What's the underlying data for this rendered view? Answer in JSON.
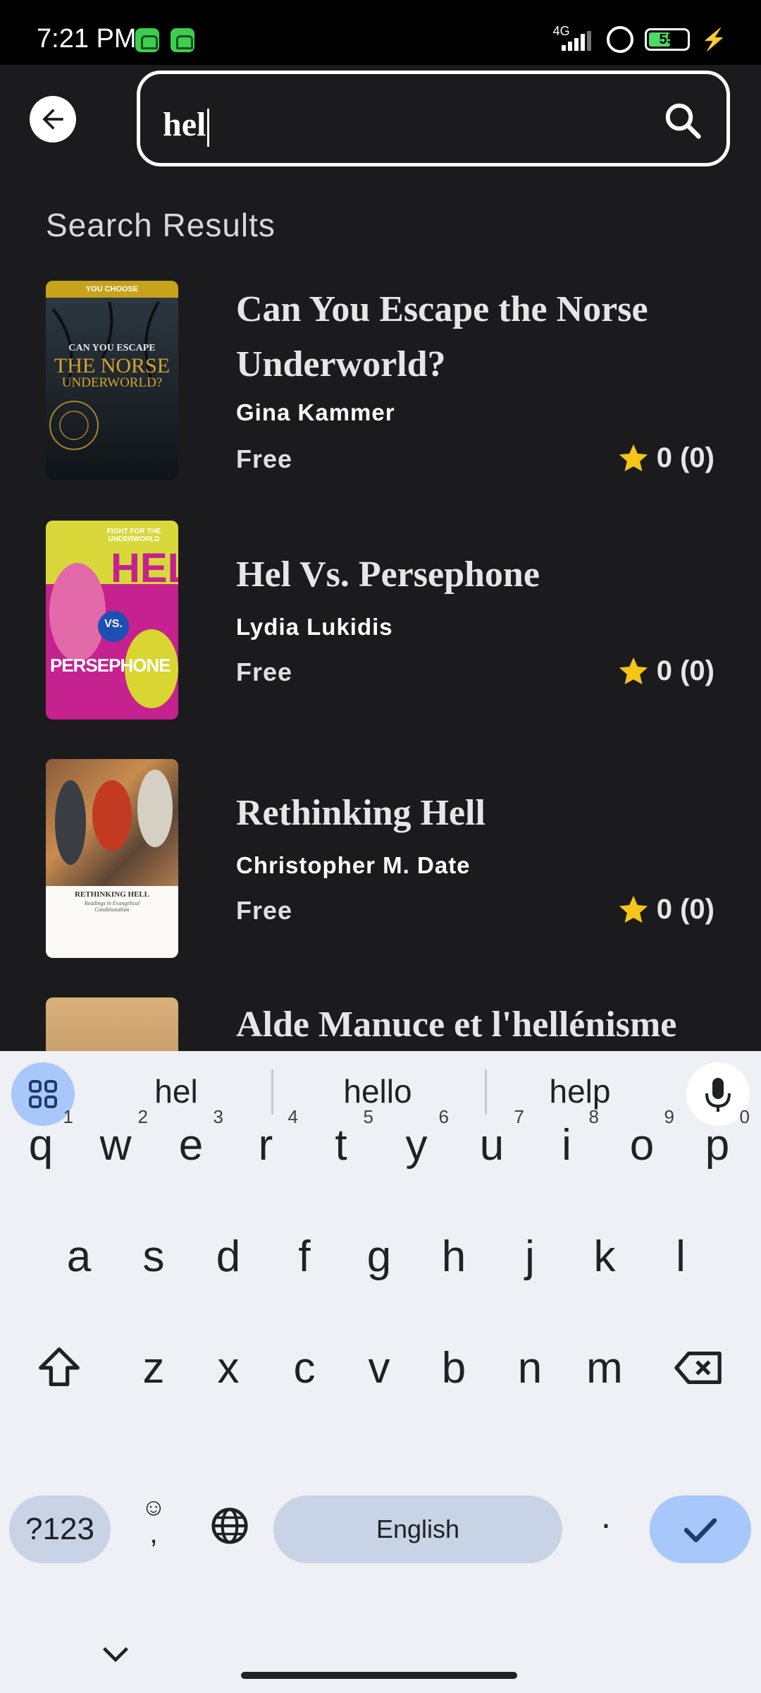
{
  "status_bar": {
    "time": "7:21 PM",
    "network": "4G",
    "battery": "55"
  },
  "header": {
    "search_value": "hel"
  },
  "section_title": "Search Results",
  "results": [
    {
      "title": "Can You Escape the Norse Underworld?",
      "author": "Gina Kammer",
      "price": "Free",
      "rating": "0 (0)"
    },
    {
      "title": "Hel Vs. Persephone",
      "author": "Lydia Lukidis",
      "price": "Free",
      "rating": "0 (0)"
    },
    {
      "title": "Rethinking Hell",
      "author": "Christopher M. Date",
      "price": "Free",
      "rating": "0 (0)"
    },
    {
      "title": "Alde Manuce et l'hellénisme",
      "author": "",
      "price": "",
      "rating": ""
    }
  ],
  "covers": [
    {
      "top_band": "YOU CHOOSE",
      "line1": "CAN YOU ESCAPE",
      "line2": "THE NORSE",
      "line3": "UNDERWORLD?"
    },
    {
      "top_band": "FIGHT FOR THE UNDERWORLD",
      "big1": "HEL",
      "vs": "VS.",
      "big2": "PERSEPHONE"
    },
    {
      "line1": "RETHINKING HELL",
      "line2": "Readings in Evangelical Conditionalism"
    }
  ],
  "keyboard": {
    "suggestions": [
      "hel",
      "hello",
      "help"
    ],
    "row1": [
      "q",
      "w",
      "e",
      "r",
      "t",
      "y",
      "u",
      "i",
      "o",
      "p"
    ],
    "row1_nums": [
      "1",
      "2",
      "3",
      "4",
      "5",
      "6",
      "7",
      "8",
      "9",
      "0"
    ],
    "row2": [
      "a",
      "s",
      "d",
      "f",
      "g",
      "h",
      "j",
      "k",
      "l"
    ],
    "row3": [
      "z",
      "x",
      "c",
      "v",
      "b",
      "n",
      "m"
    ],
    "symbols_key": "?123",
    "emoji_key": ",",
    "space_label": "English",
    "period_key": "."
  }
}
